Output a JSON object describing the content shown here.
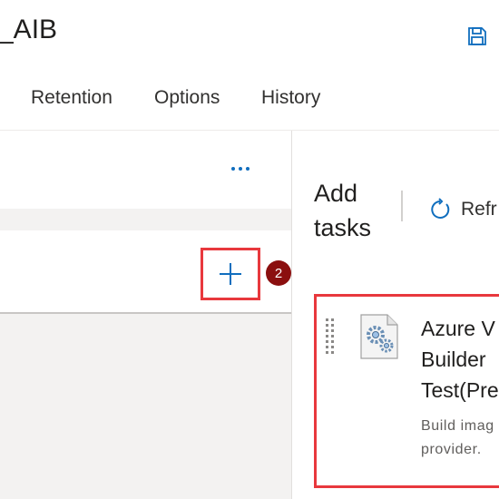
{
  "header": {
    "title": "_AIB",
    "save_icon": "save-icon"
  },
  "tabs": [
    {
      "label": "Retention"
    },
    {
      "label": "Options"
    },
    {
      "label": "History"
    }
  ],
  "left_pane": {
    "more_icon": "more-horizontal-icon",
    "add_icon": "plus-icon",
    "step_badge": "2"
  },
  "right_pane": {
    "title": "Add tasks",
    "refresh_label": "Refr",
    "refresh_icon": "refresh-icon",
    "task": {
      "name": "Azure V Builder Test(Pre",
      "description": "Build imag Image B provider.",
      "icon": "gear-task-icon",
      "drag_icon": "drag-handle-icon"
    }
  },
  "colors": {
    "accent": "#106ebe",
    "highlight": "#e8383d",
    "badge": "#8b0f0f"
  }
}
